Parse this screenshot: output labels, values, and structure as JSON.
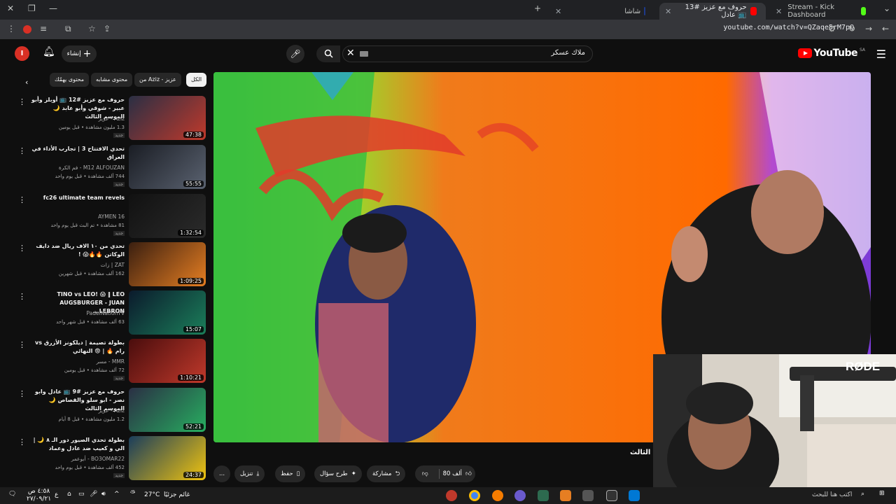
{
  "browser": {
    "tabs": [
      {
        "label": "Stream - Kick Dashboard",
        "active": false
      },
      {
        "label": "حروف مع عزيز #13 📺 عادل",
        "active": true
      },
      {
        "label": "شاشا",
        "active": false
      }
    ],
    "new_tab": "+",
    "url": "youtube.com/watch?v=QZaqe5rM7pQ"
  },
  "youtube": {
    "logo_text": "YouTube",
    "logo_region": "SA",
    "search_value": "ملاك عسكر",
    "create_label": "إنشاء",
    "avatar_letter": "I",
    "chips": [
      "الكل",
      "من Aziz - عزيز",
      "محتوى مشابه",
      "محتوى يهمّك"
    ],
    "recommendations": [
      {
        "title": "حروف مع عزيز #12 📺 أوبلز وأبو عبير - شوقي وأبو عابد 🌙 الموسم الثالث",
        "channel": "Aziz - عزيز",
        "meta": "1.3 مليون مشاهدة • قبل يومين",
        "duration": "47:38",
        "badge": "جديد",
        "colors": [
          "#2a2f44",
          "#c0392b"
        ]
      },
      {
        "title": "تحدي الافتتاح 3 | تجارب الأداء في العراق",
        "channel": "M12 ALFOUZAN - فم الكرة",
        "meta": "744 ألف مشاهدة • قبل يوم واحد",
        "duration": "55:55",
        "badge": "جديد",
        "colors": [
          "#1a1d24",
          "#5a6270"
        ]
      },
      {
        "title": "fc26 ultimate team revels",
        "channel": "AYMEN 16",
        "meta": "81 مشاهدة • تم البث قبل يوم واحد",
        "duration": "1:32:54",
        "badge": "جديد",
        "colors": [
          "#111",
          "#2b2b2b"
        ]
      },
      {
        "title": "تحدي من ١٠ الاف ريال ضد دايف الوكاتن 🔥🔥😱 !",
        "channel": "ZAT | زات",
        "meta": "162 ألف مشاهدة • قبل شهرين",
        "duration": "1:09:25",
        "badge": "",
        "colors": [
          "#3a1f10",
          "#e67e22"
        ]
      },
      {
        "title": "TINO vs LEO! 😱 ‖ LEO AUGSBURGER - JUAN LEBRON...",
        "channel": "PadelNationTV",
        "meta": "63 ألف مشاهدة • قبل شهر واحد",
        "duration": "15:07",
        "badge": "",
        "colors": [
          "#0b1a2c",
          "#1b7f5a"
        ]
      },
      {
        "title": "بطولة تصيمة | ديلكونز الأزرق vs رام 🔥 | 😨 النهائي",
        "channel": "MMR - مسر",
        "meta": "72 ألف مشاهدة • قبل يومين",
        "duration": "1:10:21",
        "badge": "جديد",
        "colors": [
          "#4a0d0d",
          "#c0392b"
        ]
      },
      {
        "title": "حروف مع عزيز #9 📺 عادل وابو نصر - ابو سلو والقصاص 🌙 الموسم الثالث",
        "channel": "Aziz - عزيز",
        "meta": "1.2 مليون مشاهدة • قبل 8 أيام",
        "duration": "52:21",
        "badge": "",
        "colors": [
          "#2a2f44",
          "#27ae60"
        ]
      },
      {
        "title": "بطولة تحدي الصيور دور الـ ٨ 🌙 | الي و كعيب ضد عادل وعماد",
        "channel": "BO3OMAR22 - أبوعمر",
        "meta": "452 ألف مشاهدة • قبل يوم واحد",
        "duration": "24:37",
        "badge": "جديد",
        "colors": [
          "#1a3d5c",
          "#f1c40f"
        ]
      }
    ],
    "video": {
      "title_partial": "م الثالث",
      "actions": {
        "like_count": "80 ألف",
        "share": "مشاركة",
        "ask": "طرح سؤال",
        "save": "حفظ",
        "download": "تنزيل",
        "more": "..."
      }
    }
  },
  "cam_label": "RØDE",
  "taskbar": {
    "search_placeholder": "اكتب هنا للبحث",
    "weather_temp": "27°C",
    "weather_text": "غائم جزئيًا",
    "time": "٤:٥٨ ص",
    "date": "٢٧/٠٩/٢١",
    "lang": "ع"
  },
  "colors": {
    "yt_red": "#ff0000",
    "bg": "#0f0f0f",
    "chip": "#272727"
  }
}
